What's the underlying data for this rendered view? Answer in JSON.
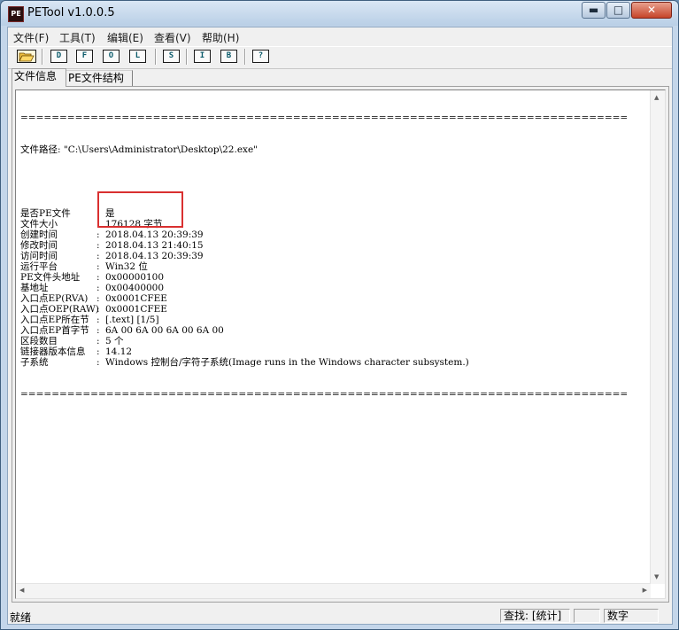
{
  "window": {
    "icon_text": "PE",
    "title": "PETool v1.0.0.5",
    "min_glyph": "▬",
    "max_glyph": "□",
    "close_glyph": "✕"
  },
  "menu": [
    "文件(F)",
    "工具(T)",
    "编辑(E)",
    "查看(V)",
    "帮助(H)"
  ],
  "toolbar": {
    "open_icon": "folder-open-icon",
    "buttons": [
      "D",
      "F",
      "O",
      "L",
      "S",
      "I",
      "B",
      "?"
    ]
  },
  "tabs": [
    "文件信息",
    "PE文件结构"
  ],
  "content": {
    "divider": "==============================================================================",
    "path_line": "文件路径: \"C:\\Users\\Administrator\\Desktop\\22.exe\"",
    "rows": [
      {
        "key": "是否PE文件",
        "value": "是"
      },
      {
        "key": "文件大小",
        "value": "176128 字节"
      },
      {
        "key": "创建时间",
        "value": "2018.04.13 20:39:39"
      },
      {
        "key": "修改时间",
        "value": "2018.04.13 21:40:15"
      },
      {
        "key": "访问时间",
        "value": "2018.04.13 20:39:39"
      },
      {
        "key": "运行平台",
        "value": "Win32 位"
      },
      {
        "key": "PE文件头地址",
        "value": "0x00000100"
      },
      {
        "key": "基地址",
        "value": "0x00400000"
      },
      {
        "key": "入口点EP(RVA)",
        "value": "0x0001CFEE"
      },
      {
        "key": "入口点OEP(RAW)",
        "value": "0x0001CFEE"
      },
      {
        "key": "入口点EP所在节",
        "value": "[.text] [1/5]"
      },
      {
        "key": "入口点EP首字节",
        "value": "6A 00 6A 00 6A 00 6A 00"
      },
      {
        "key": "区段数目",
        "value": "5 个"
      },
      {
        "key": "链接器版本信息",
        "value": "14.12"
      },
      {
        "key": "子系统",
        "value": "Windows 控制台/字符子系统(Image runs in the Windows character subsystem.)"
      }
    ],
    "separator": ":"
  },
  "status": {
    "left": "就绪",
    "find": "查找: [统计]",
    "blank": "",
    "num": "数字"
  },
  "colors": {
    "highlight_box": "#d93030",
    "title_bar": "#c4d6ea",
    "close_button": "#c6442a"
  }
}
